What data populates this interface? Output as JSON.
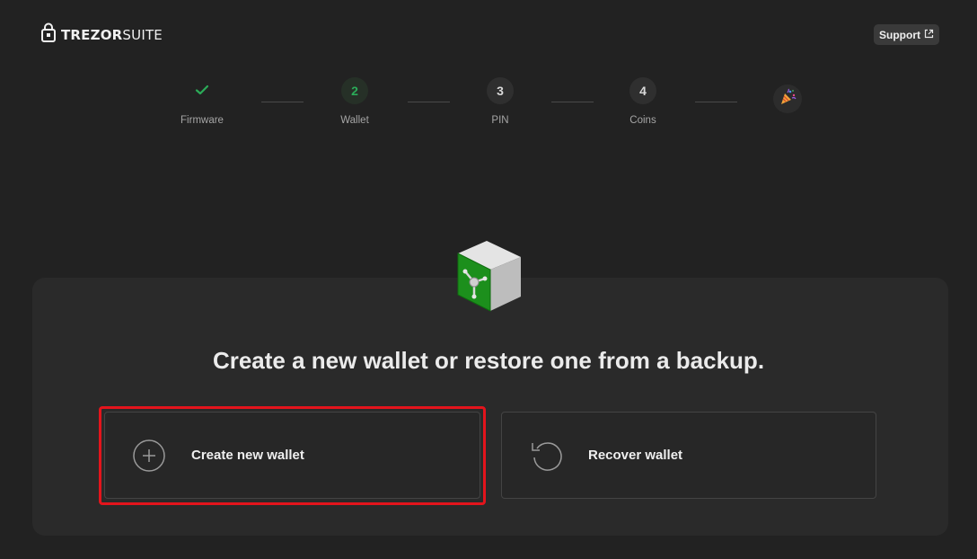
{
  "header": {
    "logo_bold": "TREZOR",
    "logo_light": "SUITE",
    "support_label": "Support"
  },
  "stepper": {
    "steps": [
      {
        "number": "",
        "label": "Firmware",
        "state": "done"
      },
      {
        "number": "2",
        "label": "Wallet",
        "state": "active"
      },
      {
        "number": "3",
        "label": "PIN",
        "state": "pending"
      },
      {
        "number": "4",
        "label": "Coins",
        "state": "pending"
      }
    ],
    "final_icon": "party-popper-icon"
  },
  "main": {
    "headline": "Create a new wallet or restore one from a backup.",
    "options": [
      {
        "label": "Create new wallet",
        "icon": "plus-circle-icon",
        "highlighted": true
      },
      {
        "label": "Recover wallet",
        "icon": "rotate-ccw-icon",
        "highlighted": false
      }
    ]
  },
  "colors": {
    "background": "#222222",
    "card": "#2a2a2a",
    "accent_green": "#2bab58",
    "highlight_red": "#e3141c"
  }
}
